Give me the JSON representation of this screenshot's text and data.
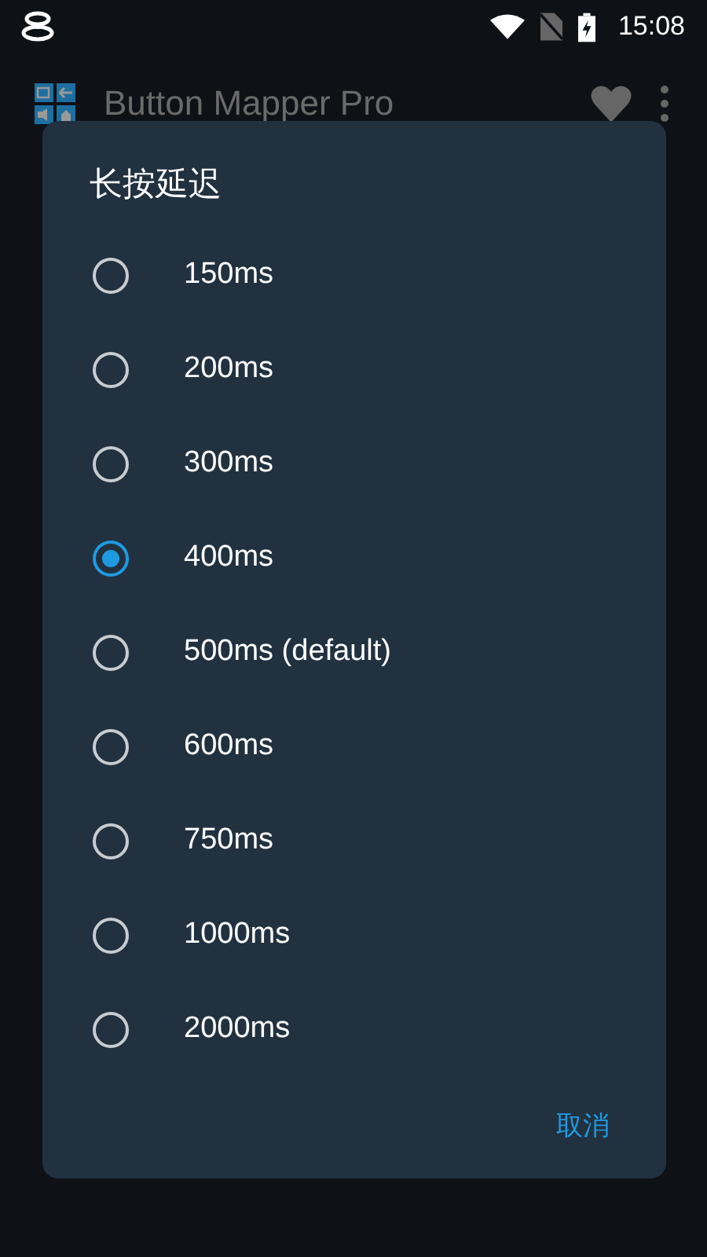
{
  "status_bar": {
    "time": "15:08"
  },
  "app_bar": {
    "title": "Button Mapper Pro"
  },
  "dialog": {
    "title": "长按延迟",
    "options": [
      {
        "label": "150ms",
        "selected": false
      },
      {
        "label": "200ms",
        "selected": false
      },
      {
        "label": "300ms",
        "selected": false
      },
      {
        "label": "400ms",
        "selected": true
      },
      {
        "label": "500ms (default)",
        "selected": false
      },
      {
        "label": "600ms",
        "selected": false
      },
      {
        "label": "750ms",
        "selected": false
      },
      {
        "label": "1000ms",
        "selected": false
      },
      {
        "label": "2000ms",
        "selected": false
      }
    ],
    "buttons": [
      "取消"
    ]
  }
}
